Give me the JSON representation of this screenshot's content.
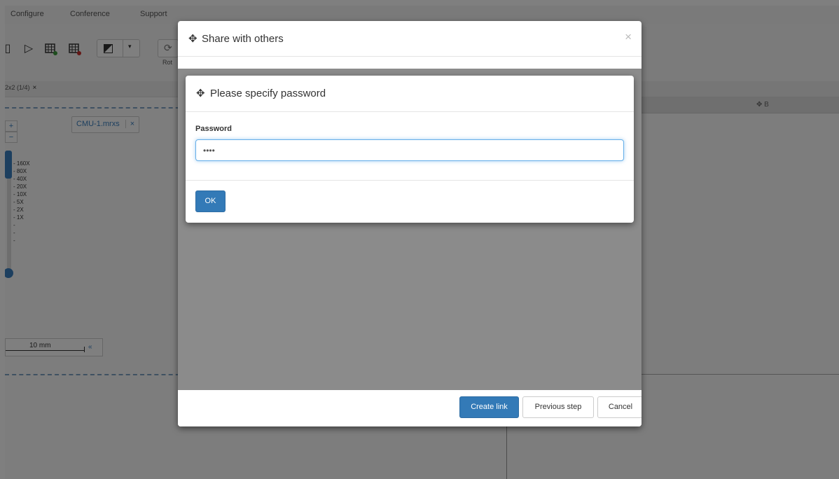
{
  "menu": [
    "Configure",
    "Conference",
    "Support"
  ],
  "toolbar": {
    "rotate_label": "Rot"
  },
  "tab": {
    "label": "2x2 (1/4)",
    "close": "×"
  },
  "viewport": {
    "slide_name": "CMU-1.mrxs",
    "slide_close": "×",
    "zoom_plus": "+",
    "zoom_minus": "−",
    "zoom_levels": [
      "- 160X",
      "- 80X",
      "- 40X",
      "- 20X",
      "- 10X",
      "- 5X",
      "- 2X",
      "- 1X",
      "-",
      "-",
      "-"
    ],
    "scale_label": "10 mm",
    "scale_collapse": "«",
    "right_panel_label": "✥ B"
  },
  "share_modal": {
    "title": "Share with others",
    "close": "×",
    "buttons": {
      "create_link": "Create link",
      "previous_step": "Previous step",
      "cancel": "Cancel"
    }
  },
  "password_modal": {
    "title": "Please specify password",
    "field_label": "Password",
    "field_value": "••••",
    "ok": "OK"
  },
  "colors": {
    "primary": "#337ab7",
    "overlay": "rgba(0,0,0,0.5)",
    "accent_blue": "#3a7fbf"
  }
}
